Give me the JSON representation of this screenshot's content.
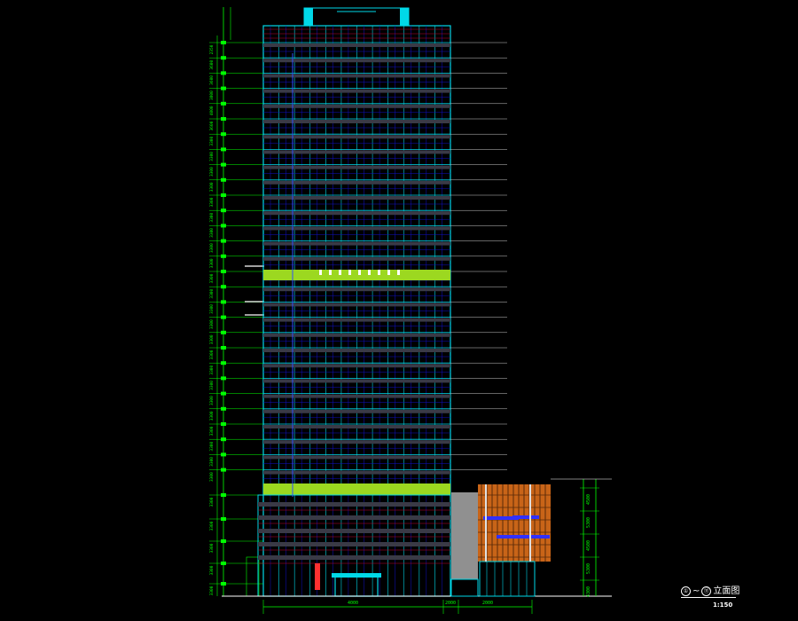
{
  "drawing": {
    "title": "立面图",
    "axis_from": "①",
    "axis_to": "⑪",
    "title_separator": "~",
    "scale": "1:150",
    "left_dims": [
      "2350",
      "3600",
      "3600",
      "3800",
      "4000",
      "3600",
      "3300",
      "3300",
      "3300",
      "3300",
      "3300",
      "3300",
      "3300",
      "3300",
      "3300",
      "3300",
      "3300",
      "3300",
      "3300",
      "3300",
      "3300",
      "3300",
      "3300",
      "3300",
      "3300",
      "3300",
      "3300",
      "3300",
      "3300",
      "3300",
      "3300",
      "3300",
      "3300",
      "3300",
      "3300",
      "3300",
      "3300"
    ],
    "bottom_dims": [
      "4000",
      "2000",
      "2000"
    ],
    "podium_dims": [
      "4500",
      "5300",
      "4500",
      "5300",
      "4300"
    ]
  },
  "colors": {
    "background": "#000000",
    "facade": "#00d8e8",
    "grid_lines": "#1010c8",
    "refuge_band": "#9cd820",
    "dimension": "#00ff00",
    "connector": "#909090",
    "podium_panel": "#c86418",
    "accent": "#ff3030"
  },
  "icons": [
    "dimension-tick-icon",
    "axis-bubble-icon"
  ]
}
